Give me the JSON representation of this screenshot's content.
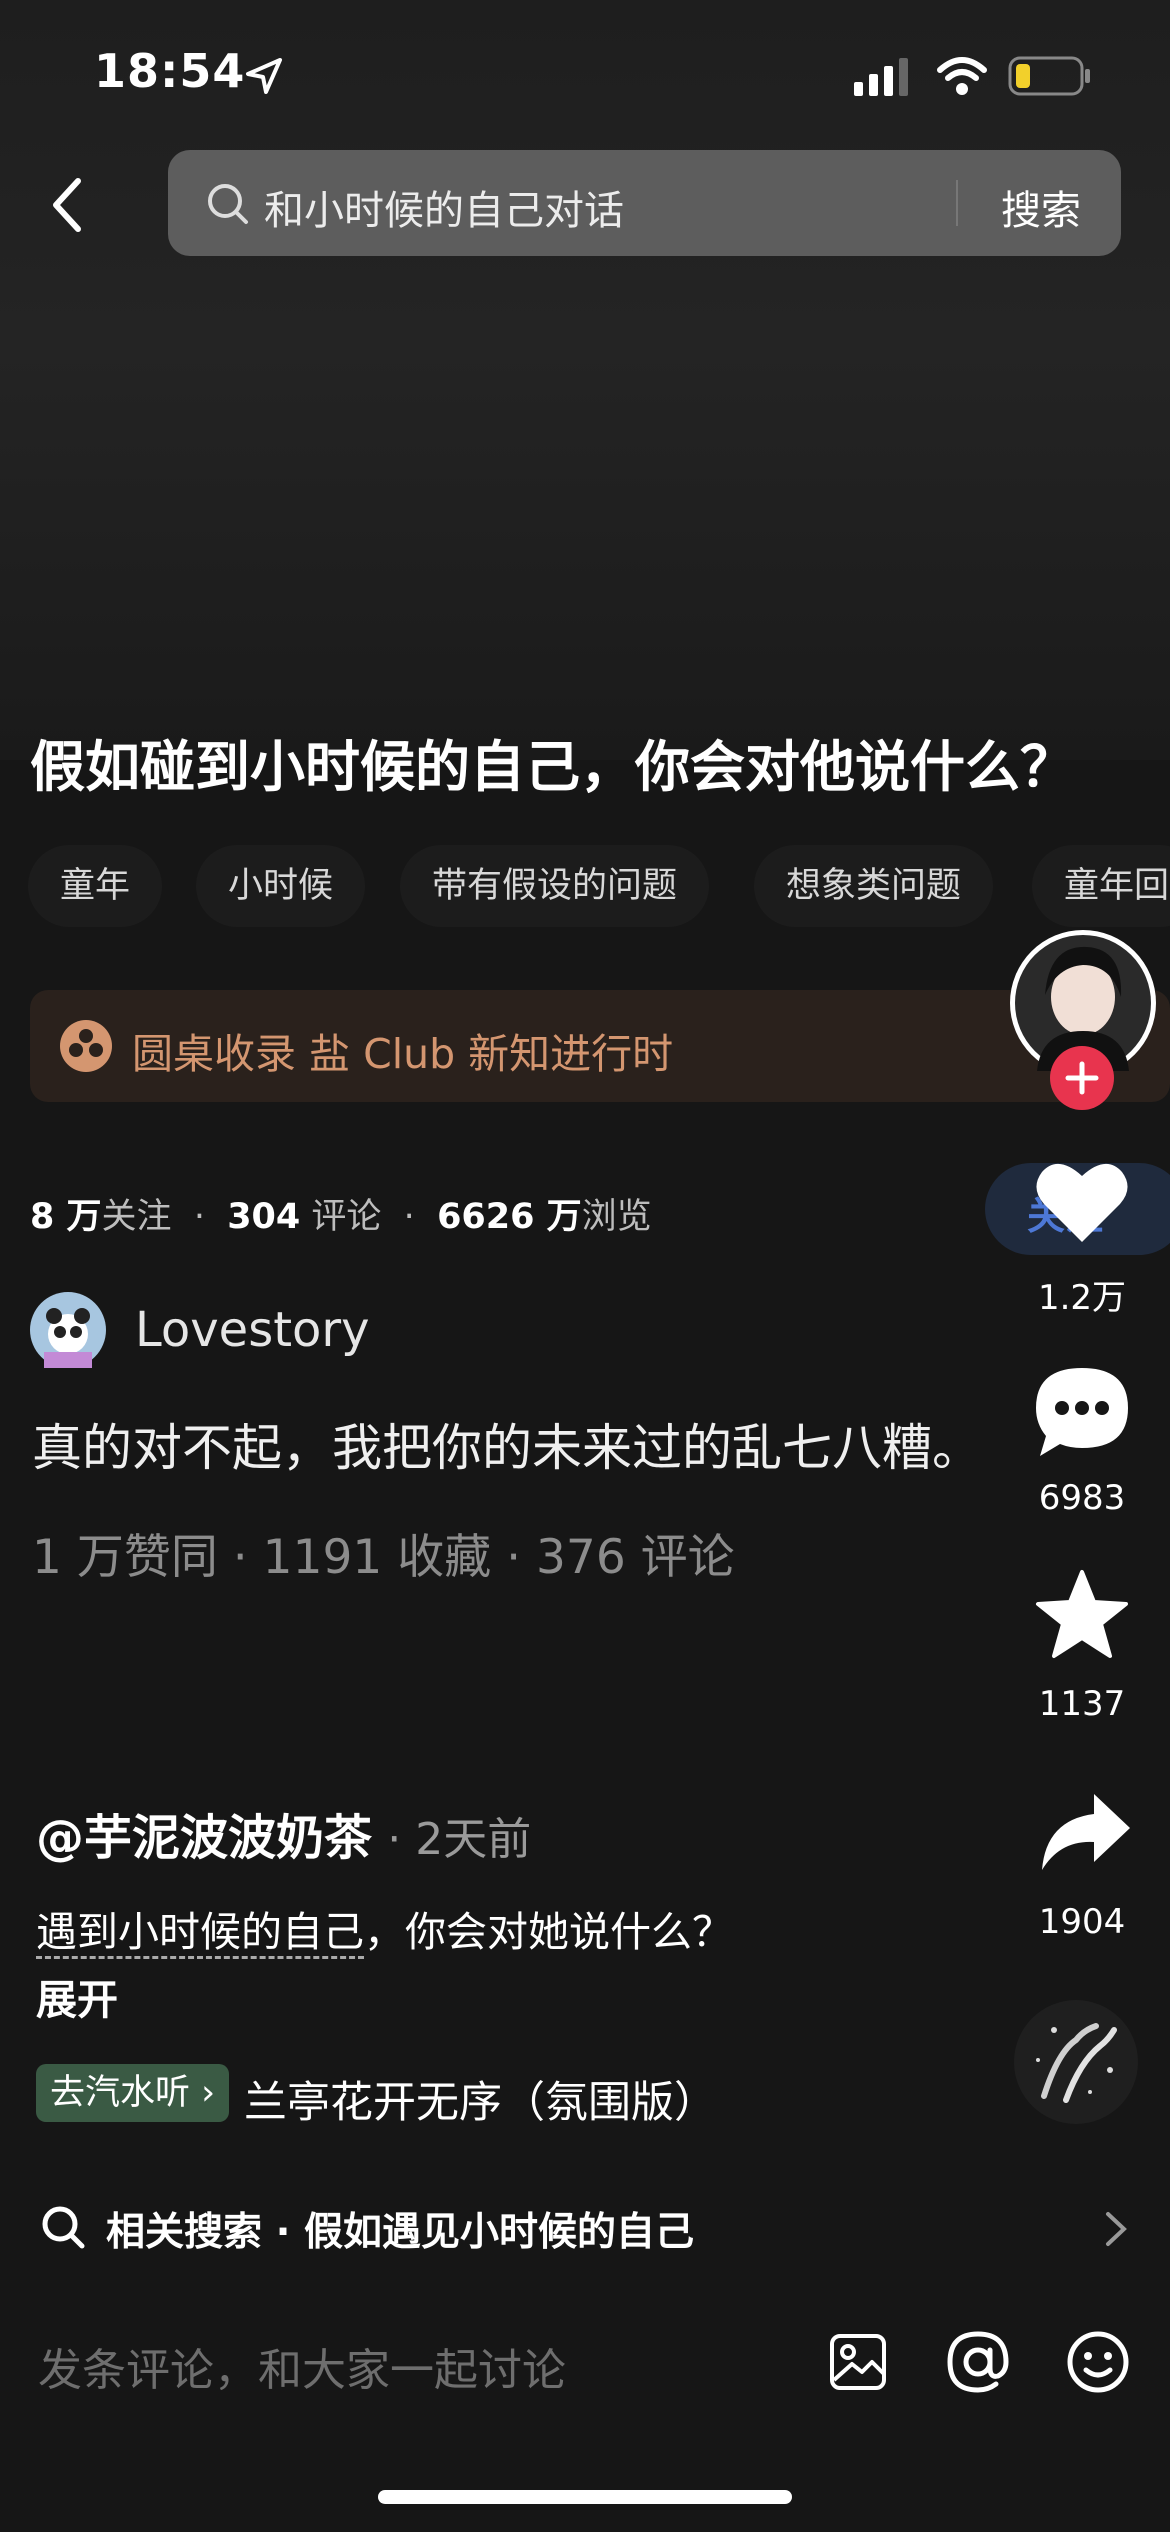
{
  "status_bar": {
    "time": "18:54"
  },
  "search": {
    "query": "和小时候的自己对话",
    "button": "搜索"
  },
  "question": {
    "title": "假如碰到小时候的自己，你会对他说什么？",
    "tags": [
      "童年",
      "小时候",
      "带有假设的问题",
      "想象类问题",
      "童年回"
    ],
    "banner": "圆桌收录 盐 Club 新知进行时",
    "followers_num": "8 万",
    "followers_label": "关注",
    "comments_num": "304",
    "comments_label": "评论",
    "views_num": "6626 万",
    "views_label": "浏览",
    "follow_button": "关注"
  },
  "answer": {
    "author": "Lovestory",
    "excerpt": "真的对不起，我把你的未来过的乱七八糟。",
    "meta": "1 万赞同 · 1191 收藏 · 376 评论"
  },
  "side_actions": {
    "likes": "1.2万",
    "comments": "6983",
    "favorites": "1137",
    "shares": "1904"
  },
  "post": {
    "username": "@芋泥波波奶茶",
    "time": "· 2天前",
    "desc_link": "遇到小时候的自己",
    "desc_rest": "，你会对她说什么？",
    "expand": "展开",
    "music_button": "去汽水听",
    "song": "兰亭花开无序（氛围版）"
  },
  "related_search": "相关搜索 · 假如遇见小时候的自己",
  "comment_placeholder": "发条评论，和大家一起讨论",
  "colors": {
    "accent_orange": "#d49670",
    "like_red": "#e8344e",
    "follow_blue": "#4d78d6"
  }
}
